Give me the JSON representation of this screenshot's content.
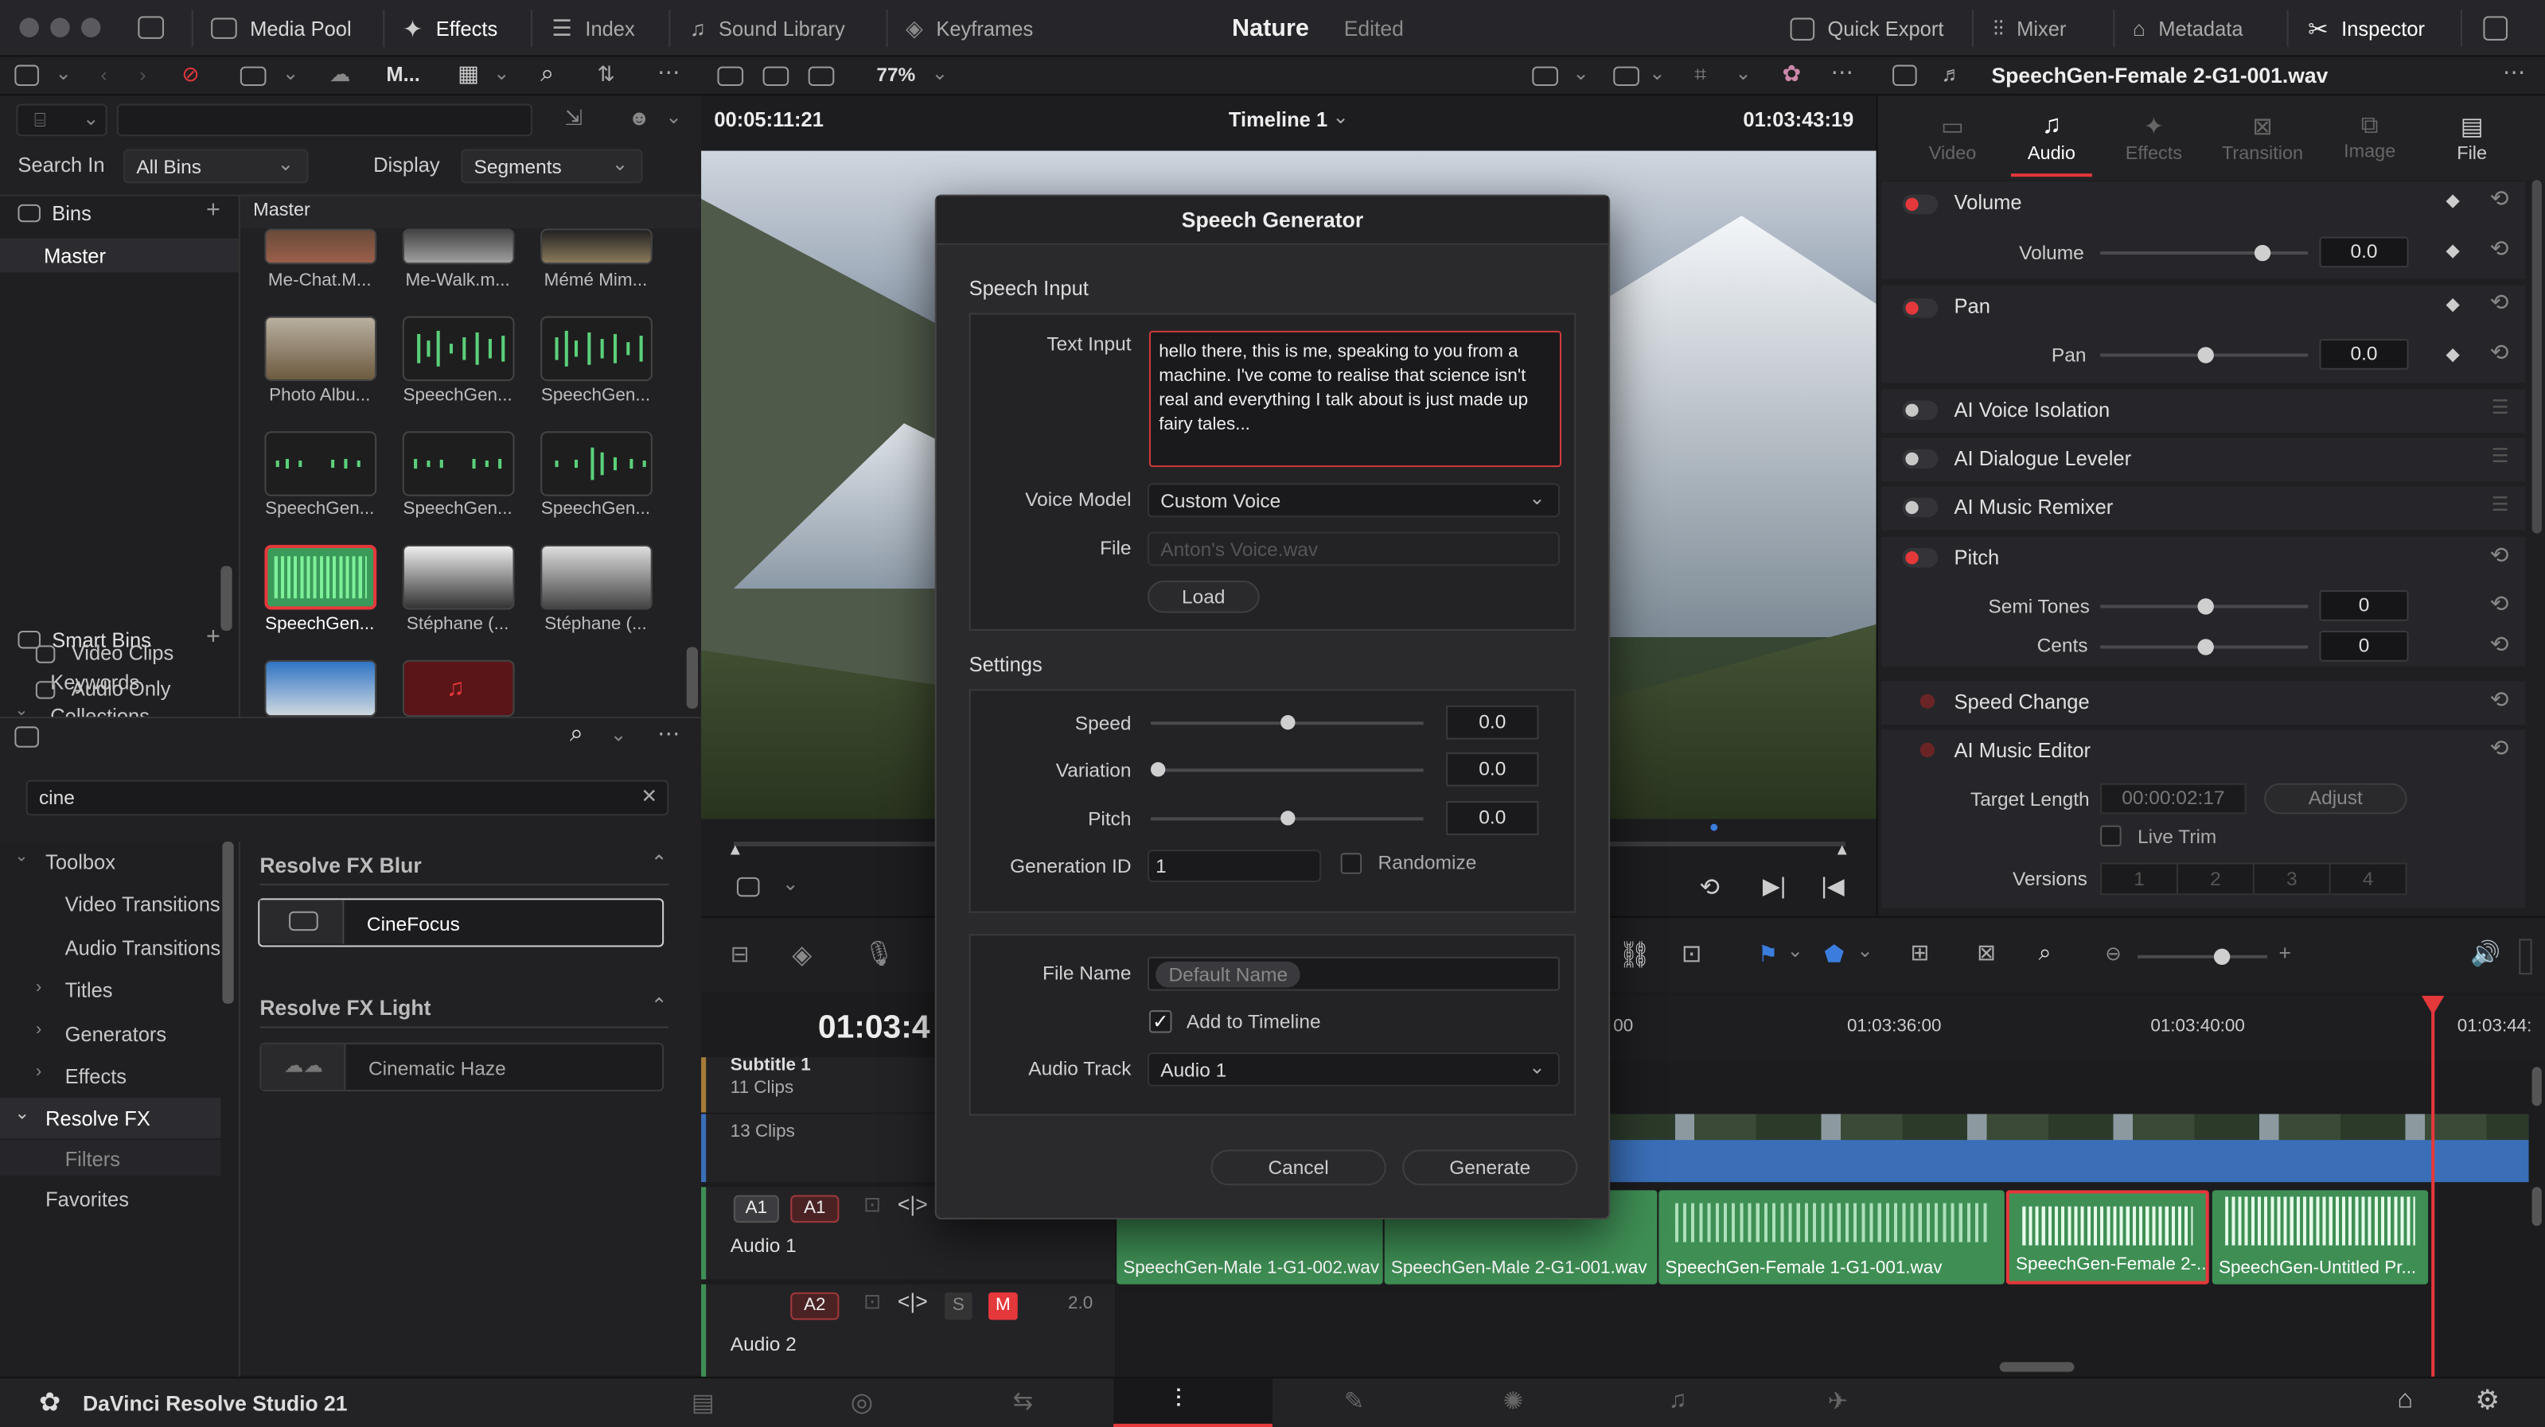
{
  "top": {
    "media_pool": "Media Pool",
    "effects": "Effects",
    "index": "Index",
    "sound_library": "Sound Library",
    "keyframes": "Keyframes",
    "project": "Nature",
    "edited": "Edited",
    "quick_export": "Quick Export",
    "mixer": "Mixer",
    "metadata": "Metadata",
    "inspector": "Inspector"
  },
  "toolbar": {
    "m": "M...",
    "zoom": "77%",
    "clip_name": "SpeechGen-Female 2-G1-001.wav"
  },
  "viewer": {
    "timecode_left": "00:05:11:21",
    "timeline": "Timeline 1",
    "timecode_right": "01:03:43:19"
  },
  "search": {
    "label": "Search In",
    "all_bins": "All Bins",
    "display": "Display",
    "segments": "Segments"
  },
  "bins": {
    "title": "Bins",
    "master": "Master",
    "smart_bins": "Smart Bins",
    "keywords": "Keywords",
    "collections": "Collections",
    "video_clips": "Video Clips",
    "audio_only": "Audio Only"
  },
  "pool": {
    "header": "Master",
    "r0": [
      "Me-Chat.M...",
      "Me-Walk.m...",
      "Mémé Mim..."
    ],
    "r1": [
      "Photo Albu...",
      "SpeechGen...",
      "SpeechGen..."
    ],
    "r2": [
      "SpeechGen...",
      "SpeechGen...",
      "SpeechGen..."
    ],
    "r3": [
      "SpeechGen...",
      "Stéphane (...",
      "Stéphane (..."
    ]
  },
  "fx": {
    "search": "cine",
    "toolbox": "Toolbox",
    "video_transitions": "Video Transitions",
    "audio_transitions": "Audio Transitions",
    "titles": "Titles",
    "generators": "Generators",
    "effects": "Effects",
    "resolve_fx": "Resolve FX",
    "filters": "Filters",
    "favorites": "Favorites",
    "blur_header": "Resolve FX Blur",
    "cinefocus": "CineFocus",
    "light_header": "Resolve FX Light",
    "haze": "Cinematic Haze"
  },
  "dialog": {
    "title": "Speech Generator",
    "speech_input": "Speech Input",
    "text_input_label": "Text Input",
    "text": "hello there, this is me, speaking to you from a machine. I've come to realise that science isn't real and everything I talk about is just made up fairy tales...",
    "voice_model_label": "Voice Model",
    "voice_model": "Custom Voice",
    "file_label": "File",
    "file_placeholder": "Anton's Voice.wav",
    "load": "Load",
    "settings": "Settings",
    "speed_label": "Speed",
    "speed": "0.0",
    "variation_label": "Variation",
    "variation": "0.0",
    "pitch_label": "Pitch",
    "pitch": "0.0",
    "gen_id_label": "Generation ID",
    "gen_id": "1",
    "randomize": "Randomize",
    "file_name_label": "File Name",
    "file_name": "Default Name",
    "add_to_timeline": "Add to Timeline",
    "audio_track_label": "Audio Track",
    "audio_track": "Audio 1",
    "cancel": "Cancel",
    "generate": "Generate"
  },
  "inspector": {
    "tabs": [
      "Video",
      "Audio",
      "Effects",
      "Transition",
      "Image",
      "File"
    ],
    "volume": "Volume",
    "volume_label": "Volume",
    "volume_val": "0.0",
    "pan": "Pan",
    "pan_label": "Pan",
    "pan_val": "0.0",
    "voice_iso": "AI Voice Isolation",
    "dialogue": "AI Dialogue Leveler",
    "remixer": "AI Music Remixer",
    "pitch": "Pitch",
    "semi_tones": "Semi Tones",
    "semi_val": "0",
    "cents": "Cents",
    "cents_val": "0",
    "speed_change": "Speed Change",
    "music_editor": "AI Music Editor",
    "target_length": "Target Length",
    "target_val": "00:00:02:17",
    "adjust": "Adjust",
    "live_trim": "Live Trim",
    "versions": "Versions",
    "vnums": [
      "1",
      "2",
      "3",
      "4"
    ]
  },
  "timeline": {
    "big_tc": "01:03:4",
    "ruler": [
      "00",
      "01:03:36:00",
      "01:03:40:00",
      "01:03:44:"
    ],
    "subtitle": "Subtitle 1",
    "subtitle_clips": "11 Clips",
    "v_clips": "13 Clips",
    "a1": "A1",
    "a1b": "A1",
    "audio1": "Audio 1",
    "a2": "A2",
    "s": "S",
    "m": "M",
    "level": "2.0",
    "audio2": "Audio 2",
    "clips": [
      "SpeechGen-Male 1-G1-002.wav",
      "SpeechGen-Male 2-G1-001.wav",
      "SpeechGen-Female 1-G1-001.wav",
      "SpeechGen-Female 2-...",
      "SpeechGen-Untitled Pr..."
    ]
  },
  "bottom": {
    "app": "DaVinci Resolve Studio 21"
  }
}
